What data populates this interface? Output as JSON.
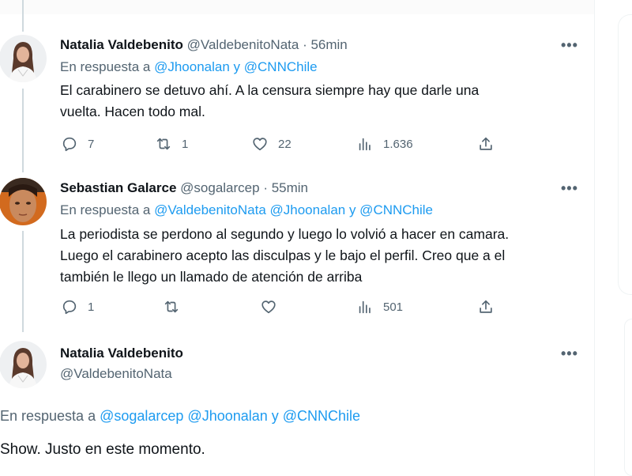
{
  "tweets": [
    {
      "name": "Natalia Valdebenito",
      "handle": "@ValdebenitoNata",
      "time": "· 56min",
      "reply_prefix": "En respuesta a",
      "mentions": "@Jhoonalan y @CNNChile",
      "text_lines": [
        "El carabinero se detuvo ahí. A la censura siempre hay que darle una",
        "vuelta. Hacen todo mal."
      ],
      "replies": "7",
      "retweets": "1",
      "likes": "22",
      "views": "1.636"
    },
    {
      "name": "Sebastian Galarce",
      "handle": "@sogalarcep",
      "time": "· 55min",
      "reply_prefix": "En respuesta a",
      "mentions": "@ValdebenitoNata @Jhoonalan y @CNNChile",
      "text_lines": [
        "La periodista se perdono al segundo y luego lo volvió a hacer en camara.",
        "Luego el carabinero acepto las disculpas y le bajo el perfil. Creo que a el",
        "también le llego un llamado de atención de arriba"
      ],
      "replies": "1",
      "views": "501"
    }
  ],
  "main_tweet": {
    "name": "Natalia Valdebenito",
    "handle": "@ValdebenitoNata",
    "reply_prefix": "En respuesta a",
    "mentions": "@sogalarcep @Jhoonalan y @CNNChile",
    "text": "Show. Justo en este momento."
  },
  "more_label": "•••",
  "colors": {
    "link": "#1d9bf0",
    "secondary": "#536471",
    "primary": "#0f1419"
  },
  "icons": [
    "reply-icon",
    "retweet-icon",
    "like-icon",
    "views-icon",
    "share-icon",
    "more-icon"
  ]
}
